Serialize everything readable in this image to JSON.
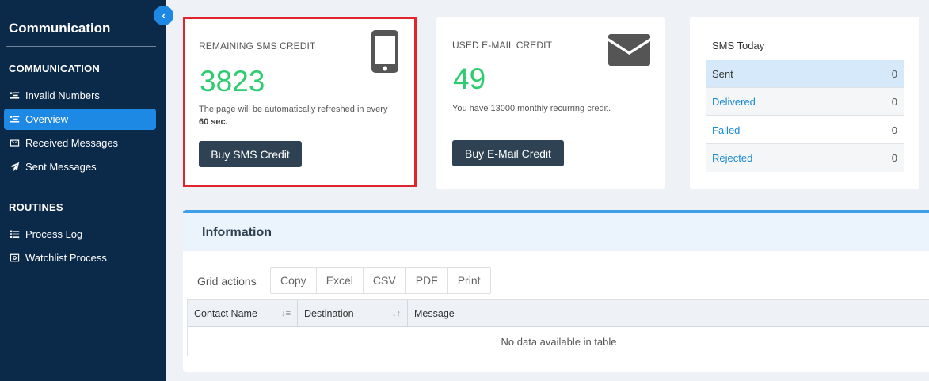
{
  "sidebar": {
    "title": "Communication",
    "sections": [
      {
        "title": "COMMUNICATION",
        "items": [
          {
            "label": "Invalid Numbers"
          },
          {
            "label": "Overview"
          },
          {
            "label": "Received Messages"
          },
          {
            "label": "Sent Messages"
          }
        ]
      },
      {
        "title": "ROUTINES",
        "items": [
          {
            "label": "Process Log"
          },
          {
            "label": "Watchlist Process"
          }
        ]
      }
    ],
    "active_item": "Overview",
    "collapse_icon": "chevron-left-icon"
  },
  "sms_card": {
    "label": "REMAINING SMS CREDIT",
    "value": "3823",
    "note_prefix": "The page will be automatically refreshed in every ",
    "note_interval": "60 sec.",
    "button": "Buy SMS Credit",
    "icon": "mobile-phone-icon"
  },
  "email_card": {
    "label": "USED E-MAIL CREDIT",
    "value": "49",
    "note": "You have 13000 monthly recurring credit.",
    "button": "Buy E-Mail Credit",
    "icon": "envelope-icon"
  },
  "sms_today": {
    "title": "SMS Today",
    "rows": [
      {
        "label": "Sent",
        "value": "0"
      },
      {
        "label": "Delivered",
        "value": "0"
      },
      {
        "label": "Failed",
        "value": "0"
      },
      {
        "label": "Rejected",
        "value": "0"
      }
    ]
  },
  "information": {
    "title": "Information",
    "grid_actions_label": "Grid actions",
    "grid_buttons": [
      "Copy",
      "Excel",
      "CSV",
      "PDF",
      "Print"
    ],
    "columns": [
      "Contact Name",
      "Destination",
      "Message"
    ],
    "empty_text": "No data available in table"
  },
  "colors": {
    "sidebar_bg": "#0b2a4a",
    "accent": "#1e88e5",
    "credit_green": "#2ecc71",
    "highlight_border": "#e0262c"
  }
}
